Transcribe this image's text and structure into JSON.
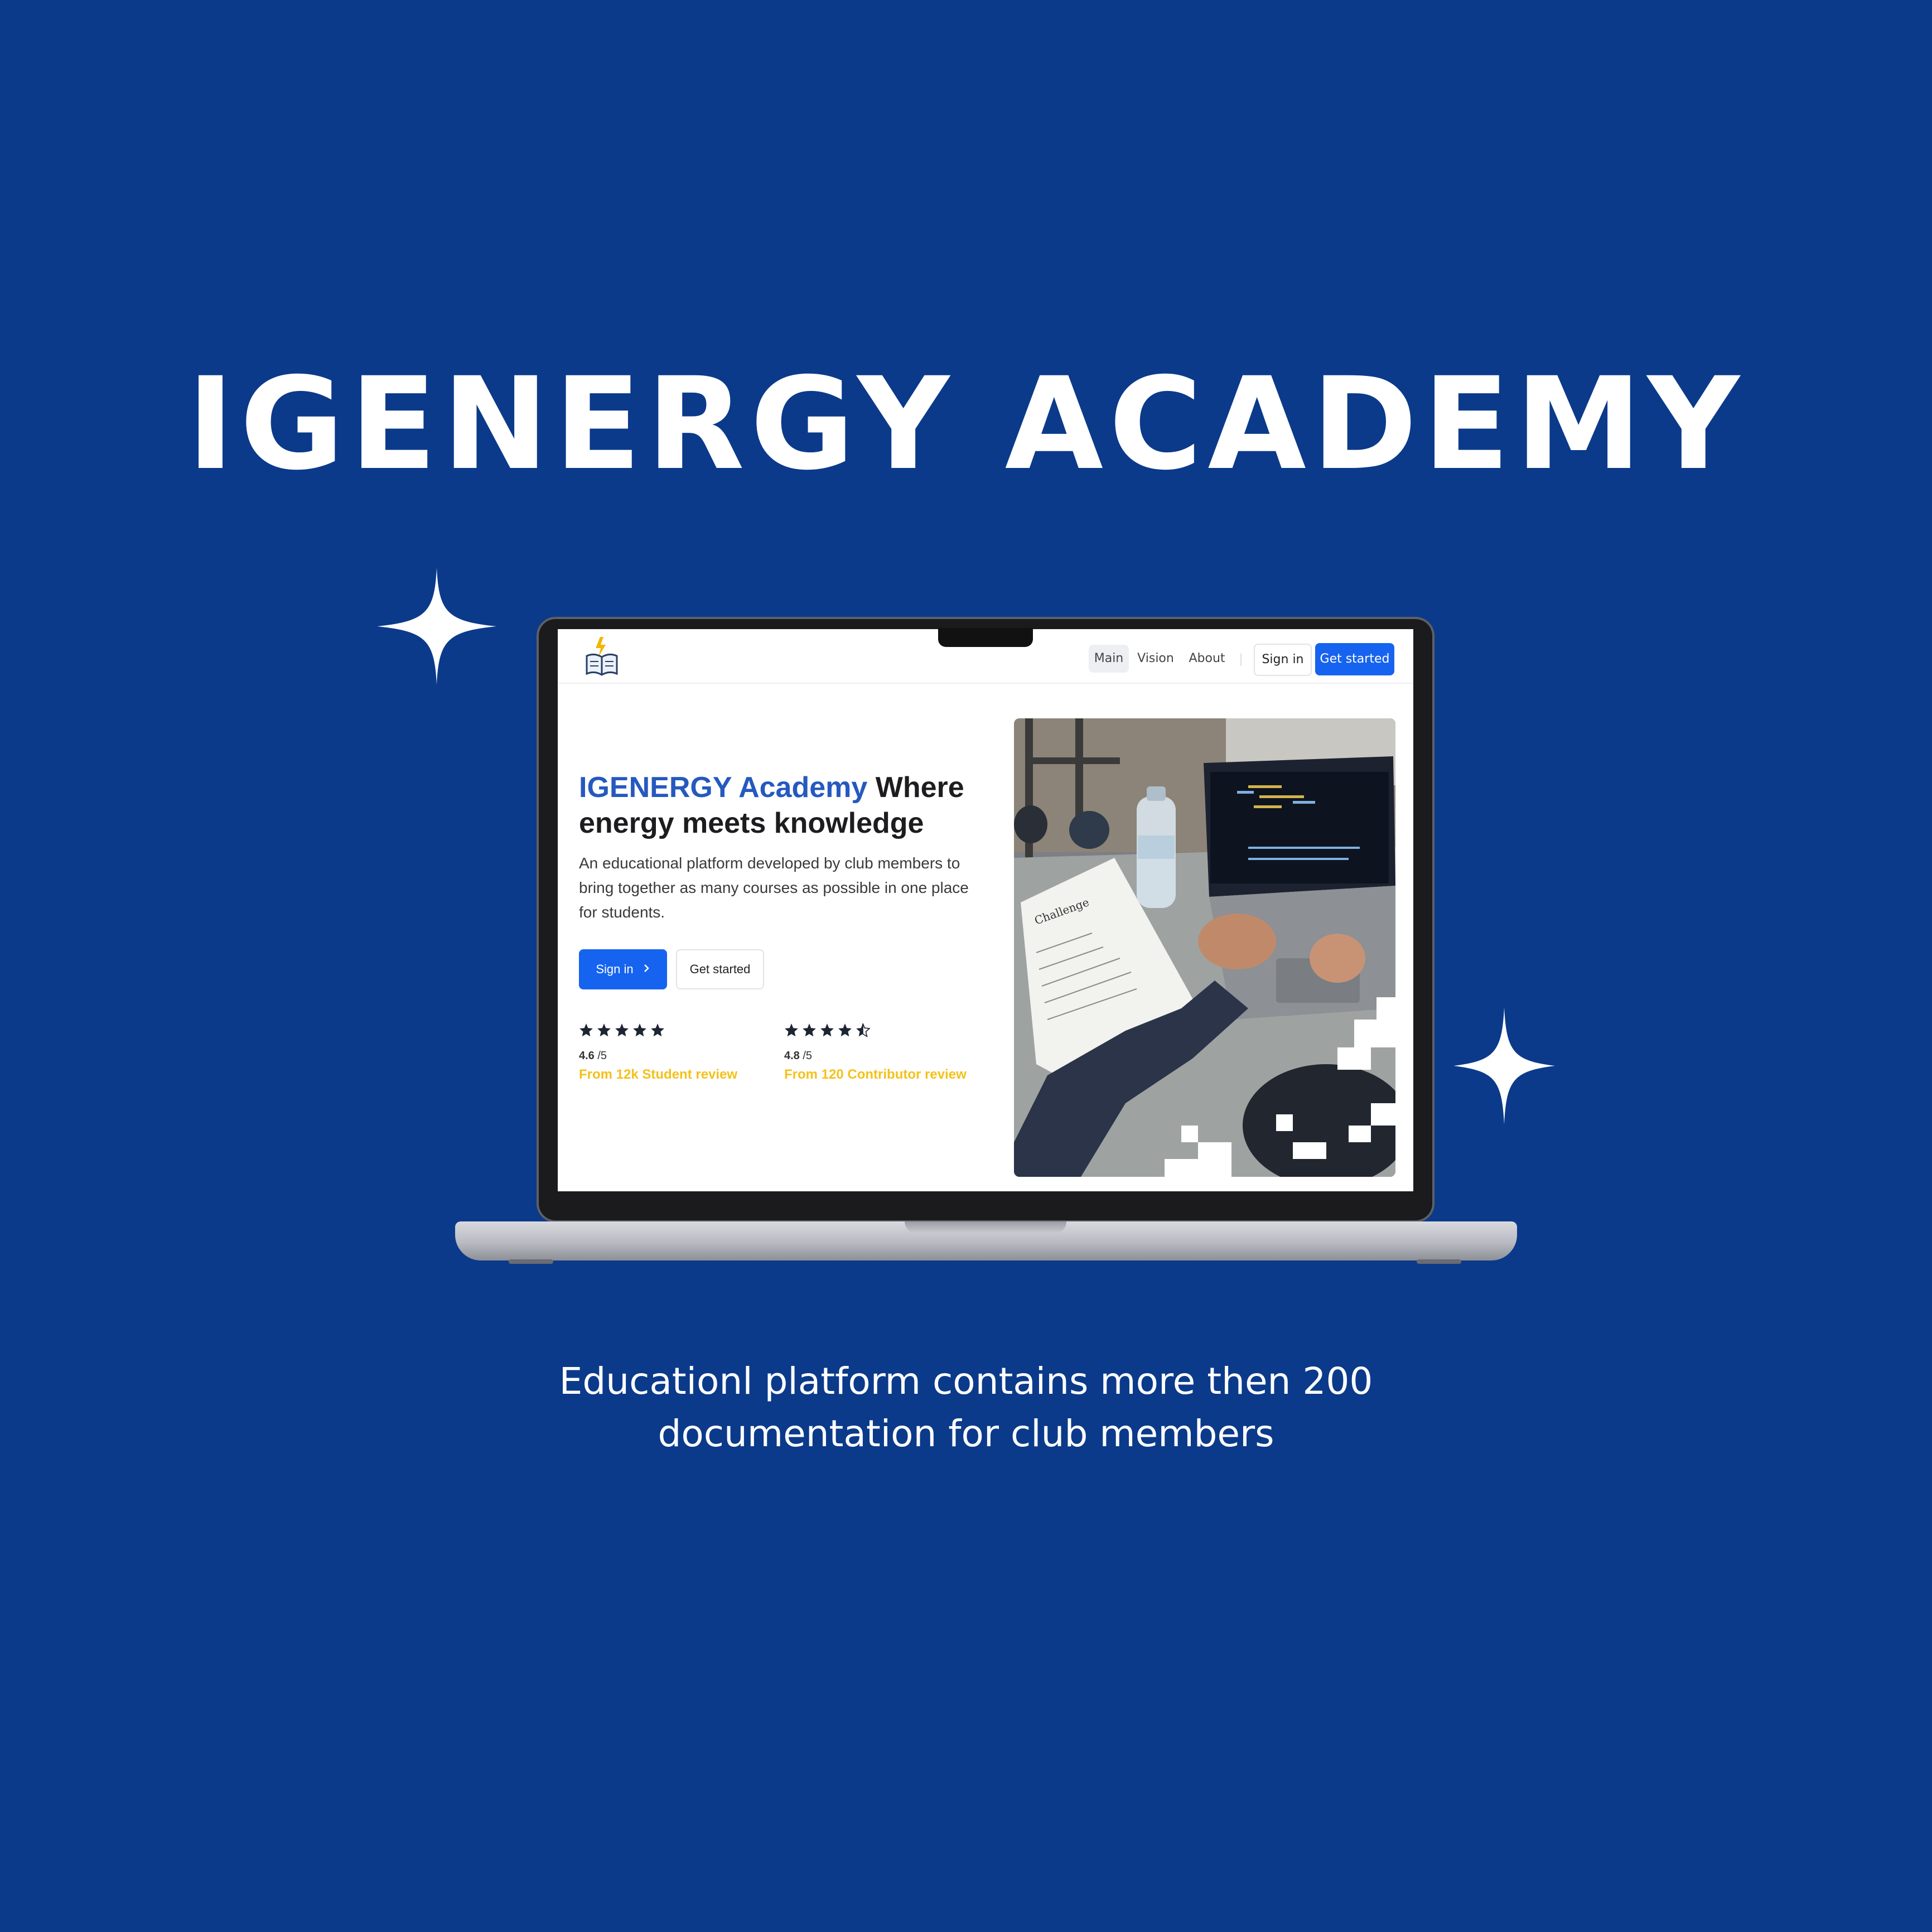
{
  "headline": "IGENERGY ACADEMY",
  "caption": {
    "line1": "Educationl platform contains more then 200",
    "line2": "documentation for club members"
  },
  "colors": {
    "background": "#0b3a8a",
    "primary_button": "#1663f0",
    "brand_text": "#2559bf",
    "review_text": "#f4c11a"
  },
  "site": {
    "logo_icon": "book-lightning-icon",
    "nav": {
      "items": [
        "Main",
        "Vision",
        "About"
      ],
      "active": "Main",
      "signin": "Sign in",
      "get_started": "Get started"
    },
    "hero": {
      "brand": "IGENERGY Academy",
      "title_rest": " Where energy meets knowledge",
      "description": "An educational platform developed by club members to bring together as many courses as possible in one place for students.",
      "signin_button": "Sign in",
      "signin_icon": "chevron-right-icon",
      "get_started_button": "Get started"
    },
    "ratings": [
      {
        "stars": 5,
        "score": "4.6",
        "out_of": "/5",
        "label": "From 12k Student review"
      },
      {
        "stars": 4.5,
        "score": "4.8",
        "out_of": "/5",
        "label": "From 120 Contributor review"
      }
    ],
    "photo": {
      "alt": "Student coding on a laptop with a challenge sheet and water bottle",
      "paper_heading": "Challenge"
    }
  }
}
